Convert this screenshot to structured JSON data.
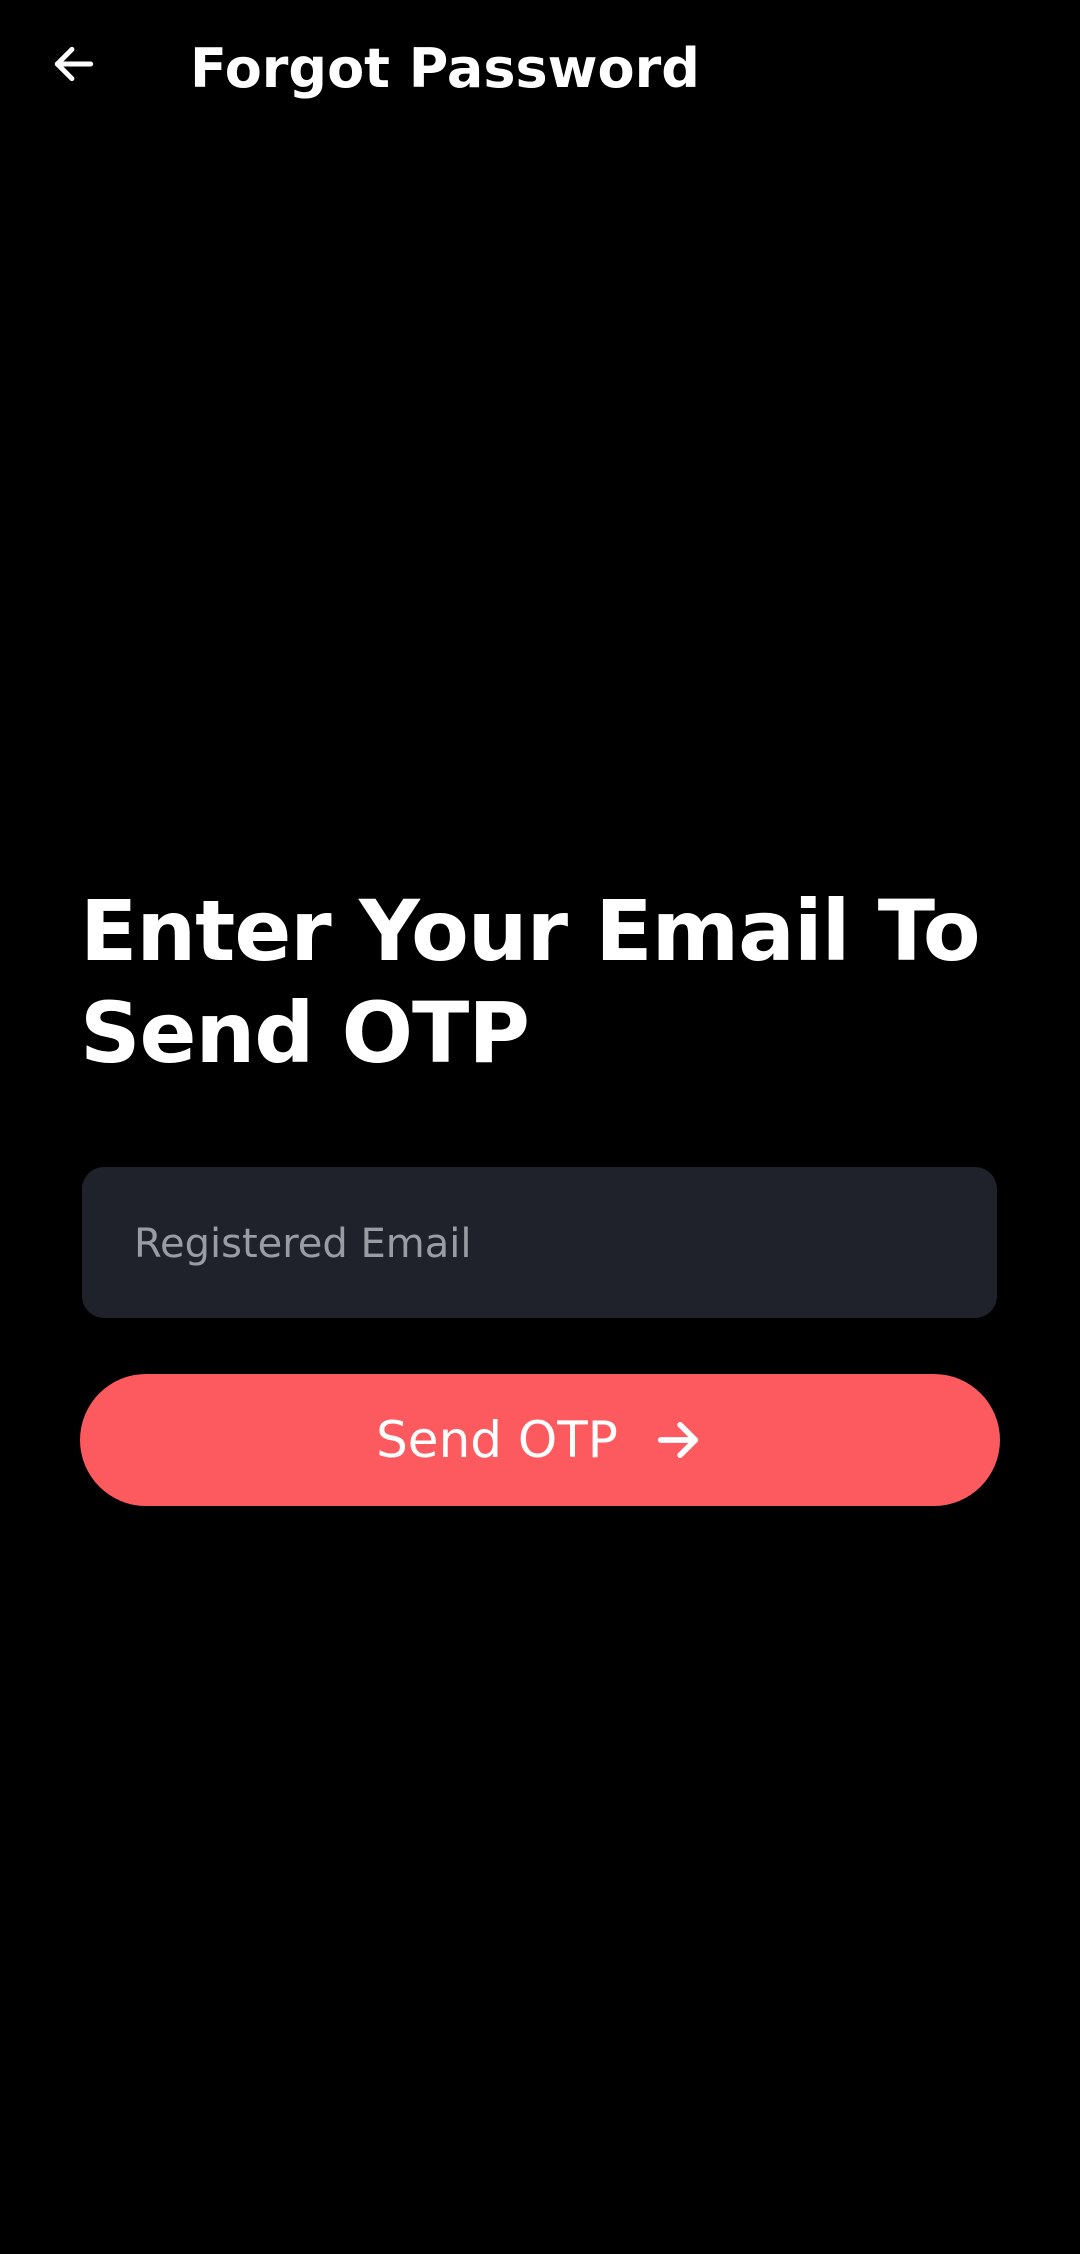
{
  "app_bar": {
    "title": "Forgot Password",
    "back_icon": "arrow-left-icon"
  },
  "main": {
    "heading_line1": "Enter Your Email To",
    "heading_line2": "Send OTP",
    "email_field": {
      "placeholder": "Registered Email",
      "value": ""
    },
    "send_button": {
      "label": "Send OTP",
      "icon": "arrow-right-icon"
    }
  },
  "colors": {
    "background": "#000000",
    "field_background": "#1f222b",
    "accent": "#fd5a5f",
    "text": "#ffffff",
    "placeholder": "#9a9ca3"
  }
}
